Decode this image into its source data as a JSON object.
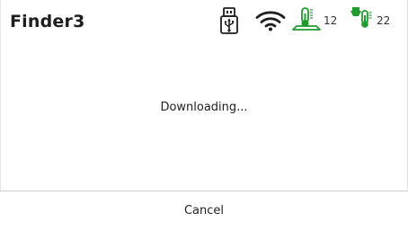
{
  "header": {
    "title": "Finder3",
    "icons": {
      "usb": "usb-drive-icon",
      "wifi": "wifi-icon",
      "bed": "heated-bed-thermometer-icon",
      "nozzle": "nozzle-thermometer-icon"
    },
    "bed_temp": "12",
    "nozzle_temp": "22"
  },
  "dialog": {
    "message": "Downloading...",
    "cancel_label": "Cancel"
  },
  "colors": {
    "accent_green": "#1f9c2e",
    "text": "#222222",
    "divider": "#cfcfcf",
    "background": "#ffffff"
  }
}
